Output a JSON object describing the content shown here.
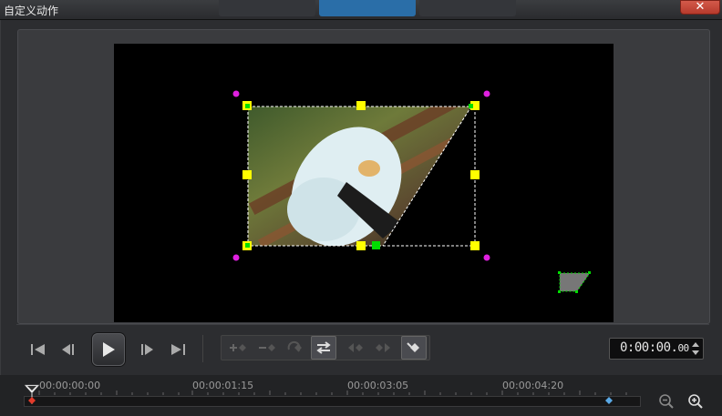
{
  "window": {
    "title": "自定义动作",
    "close_label": "✕"
  },
  "playback": {
    "timecode": "0:00:00.",
    "timecode_frames": "00"
  },
  "timeline": {
    "tick_labels": [
      "00:00:00:00",
      "00:00:01:15",
      "00:00:03:05",
      "00:00:04:20"
    ]
  },
  "icons": {
    "go_start": "skip-to-start-icon",
    "step_back": "step-back-icon",
    "play": "play-icon",
    "step_forward": "step-forward-icon",
    "go_end": "skip-to-end-icon",
    "add_keyframe": "add-keyframe-icon",
    "remove_keyframe": "remove-keyframe-icon",
    "reverse_keyframe": "reverse-keyframe-icon",
    "swap_keyframe": "swap-keyframes-icon",
    "prev_keyframe": "previous-keyframe-icon",
    "next_keyframe": "next-keyframe-icon",
    "fill_keyframe": "fill-keyframe-icon",
    "zoom_out": "zoom-out-icon",
    "zoom_in": "zoom-in-icon"
  },
  "colors": {
    "handle": "#ffff00",
    "corner_handle": "#e020e0",
    "anchor": "#00dd00",
    "keyframe_current": "#e23b2b",
    "keyframe_end": "#5aa9e6",
    "active_tab": "#2a6ea8"
  }
}
